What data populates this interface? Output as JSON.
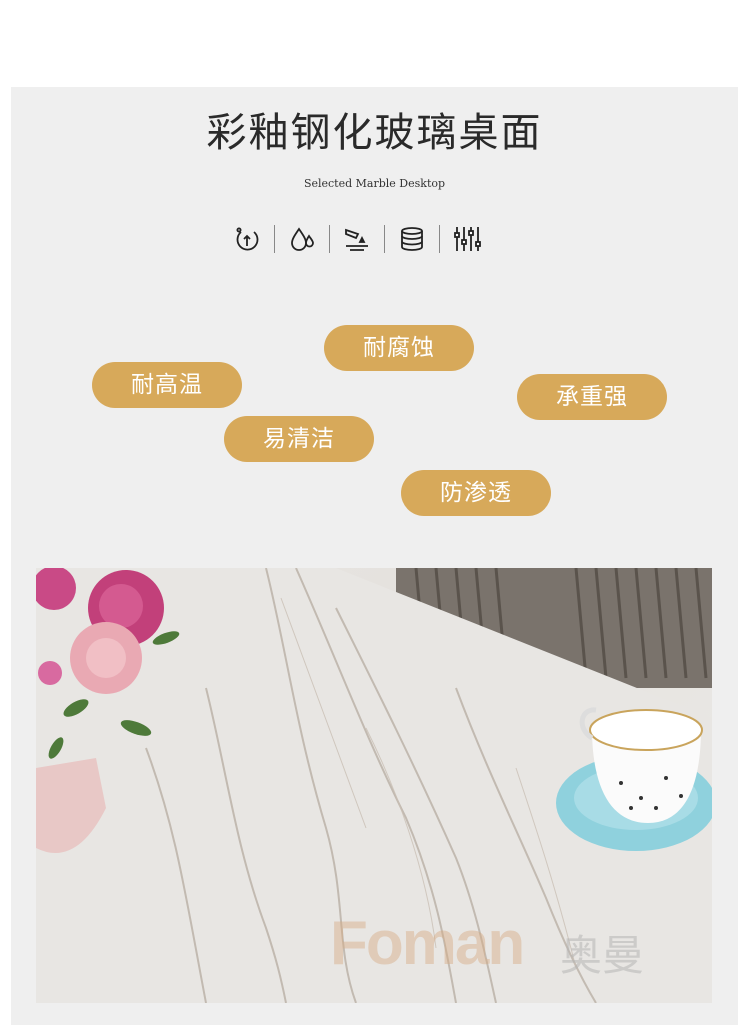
{
  "header": {
    "title": "彩釉钢化玻璃桌面",
    "subtitle": "Selected Marble Desktop"
  },
  "icons": [
    "heat-resistant-icon",
    "water-drop-icon",
    "cleaning-icon",
    "stack-layers-icon",
    "equalizer-icon"
  ],
  "features": {
    "corrosion": "耐腐蚀",
    "heat": "耐高温",
    "load": "承重强",
    "clean": "易清洁",
    "seepage": "防渗透"
  },
  "watermark": {
    "brand_en": "Foman",
    "brand_cn": "奥曼"
  },
  "colors": {
    "tag_bg": "#d7a95a",
    "panel_bg": "#efefef"
  }
}
